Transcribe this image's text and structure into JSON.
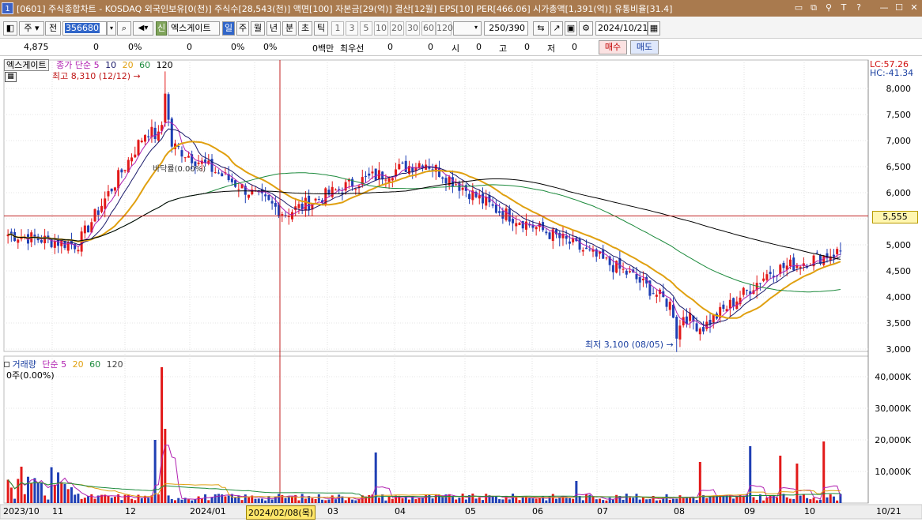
{
  "title_bar": {
    "icon_label": "1",
    "title": "[0601] 주식종합차트 - KOSDAQ 외국인보유[0(천)] 주식수[28,543(천)] 액면[100] 자본금[29(억)] 결산[12월] EPS[10] PER[466.06] 시가총액[1,391(억)] 유통비율[31.4]",
    "buttons": [
      "▭",
      "⧉",
      "⚲",
      "T",
      "?",
      "—",
      "☐",
      "✕"
    ]
  },
  "toolbar": {
    "period_select": "주",
    "prev_label": "전",
    "code_value": "356680",
    "gear_label": "신",
    "stock_name": "엑스게이트",
    "intervals": [
      "일",
      "주",
      "월",
      "년",
      "분",
      "초",
      "틱"
    ],
    "minute_values": [
      "1",
      "3",
      "5",
      "10",
      "20",
      "30",
      "60",
      "120"
    ],
    "count_value": "250",
    "count_total": "/390",
    "date_value": "2024/10/21"
  },
  "quote_row": {
    "price": "4,875",
    "change": "0",
    "change_pct": "0%",
    "volume": "0",
    "volume_pct": "0%",
    "turnover_pct": "0%",
    "amount": "0백만",
    "best_bid_label": "최우선",
    "bid1": "0",
    "bid2": "0",
    "open_label": "시",
    "open": "0",
    "high_label": "고",
    "high": "0",
    "low_label": "저",
    "low": "0",
    "buy_label": "매수",
    "sell_label": "매도"
  },
  "price_panel": {
    "stock_tag": "엑스게이트",
    "ma_label": "종가 단순",
    "ma_periods": [
      "5",
      "10",
      "20",
      "60",
      "120"
    ],
    "lc": "LC:57.26",
    "hc": "HC:-41.34",
    "high_annotation": "최고 8,310 (12/12)",
    "low_annotation": "최저 3,100 (08/05)",
    "crosshair_label": "바닥률(0.00%)",
    "current_price_label": "5,555",
    "y_ticks": [
      "8,000",
      "7,500",
      "7,000",
      "6,500",
      "6,000",
      "5,500",
      "5,000",
      "4,500",
      "4,000",
      "3,500",
      "3,000"
    ]
  },
  "volume_panel": {
    "title": "거래량",
    "ma_label": "단순",
    "ma_periods": [
      "5",
      "20",
      "60",
      "120"
    ],
    "value_label": "0주(0.00%)",
    "y_ticks": [
      "40,000K",
      "30,000K",
      "20,000K",
      "10,000K"
    ]
  },
  "x_axis": {
    "labels": [
      "2023/10",
      "11",
      "12",
      "2024/01",
      "03",
      "04",
      "05",
      "06",
      "07",
      "08",
      "09",
      "10"
    ],
    "crosshair_date": "2024/02/08(목)",
    "end_label": "10/21"
  },
  "colors": {
    "up": "#e21919",
    "down": "#1f3fb4",
    "ma5": "#b020b0",
    "ma10": "#1a1a6a",
    "ma20": "#e0a010",
    "ma60": "#1c8a3c",
    "ma120": "#000000",
    "crosshair": "#c02020",
    "price_line": "#c02020"
  },
  "chart_data": {
    "type": "candlestick",
    "x": [
      "2023/10",
      "11",
      "12",
      "2024/01",
      "02",
      "03",
      "04",
      "05",
      "06",
      "07",
      "08",
      "09",
      "10"
    ],
    "close": [
      5200,
      5000,
      7200,
      6400,
      5600,
      6200,
      6600,
      5700,
      5100,
      4400,
      3400,
      4500,
      4875
    ],
    "high": 8310,
    "low": 3100,
    "ylim": [
      3000,
      8300
    ],
    "volume_ylim": [
      0,
      45000
    ]
  }
}
